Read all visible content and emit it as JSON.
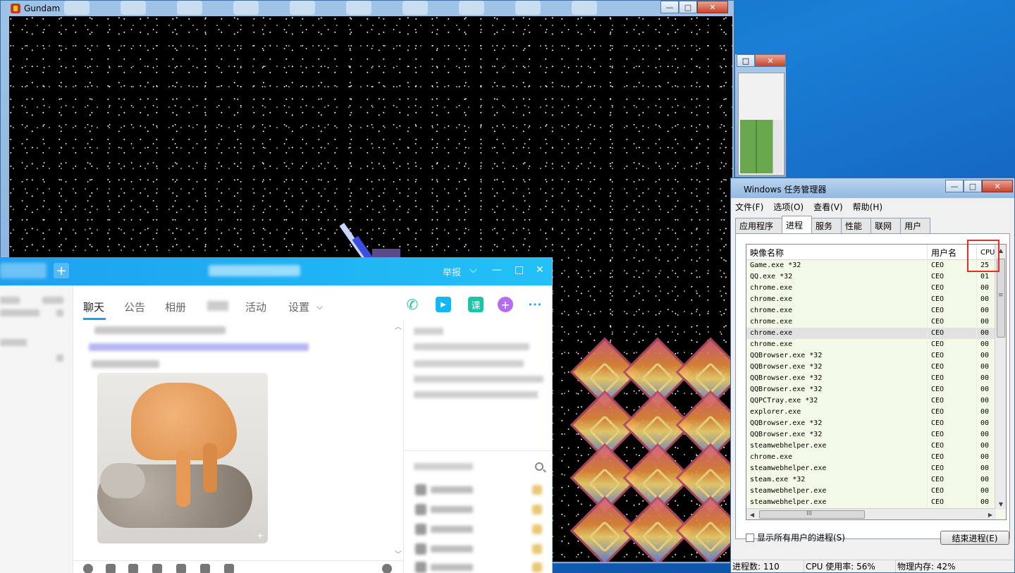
{
  "game_window": {
    "title": "Gundam",
    "controls": {
      "minimize": "—",
      "maximize": "□",
      "close": "✕"
    }
  },
  "small_window": {
    "maximize": "□",
    "close": "✕"
  },
  "task_manager": {
    "title": "Windows 任务管理器",
    "controls": {
      "minimize": "—",
      "maximize": "□",
      "close": "✕"
    },
    "menu": [
      "文件(F)",
      "选项(O)",
      "查看(V)",
      "帮助(H)"
    ],
    "tabs": [
      "应用程序",
      "进程",
      "服务",
      "性能",
      "联网",
      "用户"
    ],
    "active_tab": "进程",
    "columns": {
      "name": "映像名称",
      "user": "用户名",
      "cpu": "CPU"
    },
    "processes": [
      {
        "name": "Game.exe *32",
        "user": "CEO",
        "cpu": "25"
      },
      {
        "name": "QQ.exe *32",
        "user": "CEO",
        "cpu": "01"
      },
      {
        "name": "chrome.exe",
        "user": "CEO",
        "cpu": "00"
      },
      {
        "name": "chrome.exe",
        "user": "CEO",
        "cpu": "00"
      },
      {
        "name": "chrome.exe",
        "user": "CEO",
        "cpu": "00"
      },
      {
        "name": "chrome.exe",
        "user": "CEO",
        "cpu": "00"
      },
      {
        "name": "chrome.exe",
        "user": "CEO",
        "cpu": "00"
      },
      {
        "name": "chrome.exe",
        "user": "CEO",
        "cpu": "00"
      },
      {
        "name": "QQBrowser.exe *32",
        "user": "CEO",
        "cpu": "00"
      },
      {
        "name": "QQBrowser.exe *32",
        "user": "CEO",
        "cpu": "00"
      },
      {
        "name": "QQBrowser.exe *32",
        "user": "CEO",
        "cpu": "00"
      },
      {
        "name": "QQBrowser.exe *32",
        "user": "CEO",
        "cpu": "00"
      },
      {
        "name": "QQPCTray.exe *32",
        "user": "CEO",
        "cpu": "00"
      },
      {
        "name": "explorer.exe",
        "user": "CEO",
        "cpu": "00"
      },
      {
        "name": "QQBrowser.exe *32",
        "user": "CEO",
        "cpu": "00"
      },
      {
        "name": "QQBrowser.exe *32",
        "user": "CEO",
        "cpu": "00"
      },
      {
        "name": "steamwebhelper.exe",
        "user": "CEO",
        "cpu": "00"
      },
      {
        "name": "chrome.exe",
        "user": "CEO",
        "cpu": "00"
      },
      {
        "name": "steamwebhelper.exe",
        "user": "CEO",
        "cpu": "00"
      },
      {
        "name": "steam.exe *32",
        "user": "CEO",
        "cpu": "00"
      },
      {
        "name": "steamwebhelper.exe",
        "user": "CEO",
        "cpu": "00"
      },
      {
        "name": "steamwebhelper.exe",
        "user": "CEO",
        "cpu": "00"
      }
    ],
    "selected_row": 6,
    "scroll": {
      "up": "▲",
      "down": "▼",
      "left": "◀",
      "right": "▶",
      "grip": "≡",
      "hgrip": "III"
    },
    "show_all_label": "显示所有用户的进程(S)",
    "end_process_label": "结束进程(E)",
    "status": {
      "processes": "进程数: 110",
      "cpu": "CPU 使用率: 56%",
      "memory": "物理内存: 42%"
    }
  },
  "qq_window": {
    "add_label": "+",
    "report_label": "举报",
    "controls": {
      "dropdown": "⌵",
      "minimize": "—",
      "maximize": "□",
      "close": "✕"
    },
    "nav_tabs": [
      "聊天",
      "公告",
      "相册",
      "活动",
      "设置"
    ],
    "active_nav": "聊天",
    "nav_dropdown": "⌵",
    "tool_icons": {
      "call": "✆",
      "video": "▶",
      "lesson": "课",
      "plus": "+",
      "more": "•••"
    },
    "image_expand": "+",
    "chat_scroll": {
      "up": "︿",
      "down": "﹀"
    },
    "colors": {
      "accent": "#1ea0f0",
      "call": "#1cc48a",
      "video": "#12b7f5",
      "lesson": "#1cc4a6",
      "plus": "#b76cf0"
    }
  }
}
